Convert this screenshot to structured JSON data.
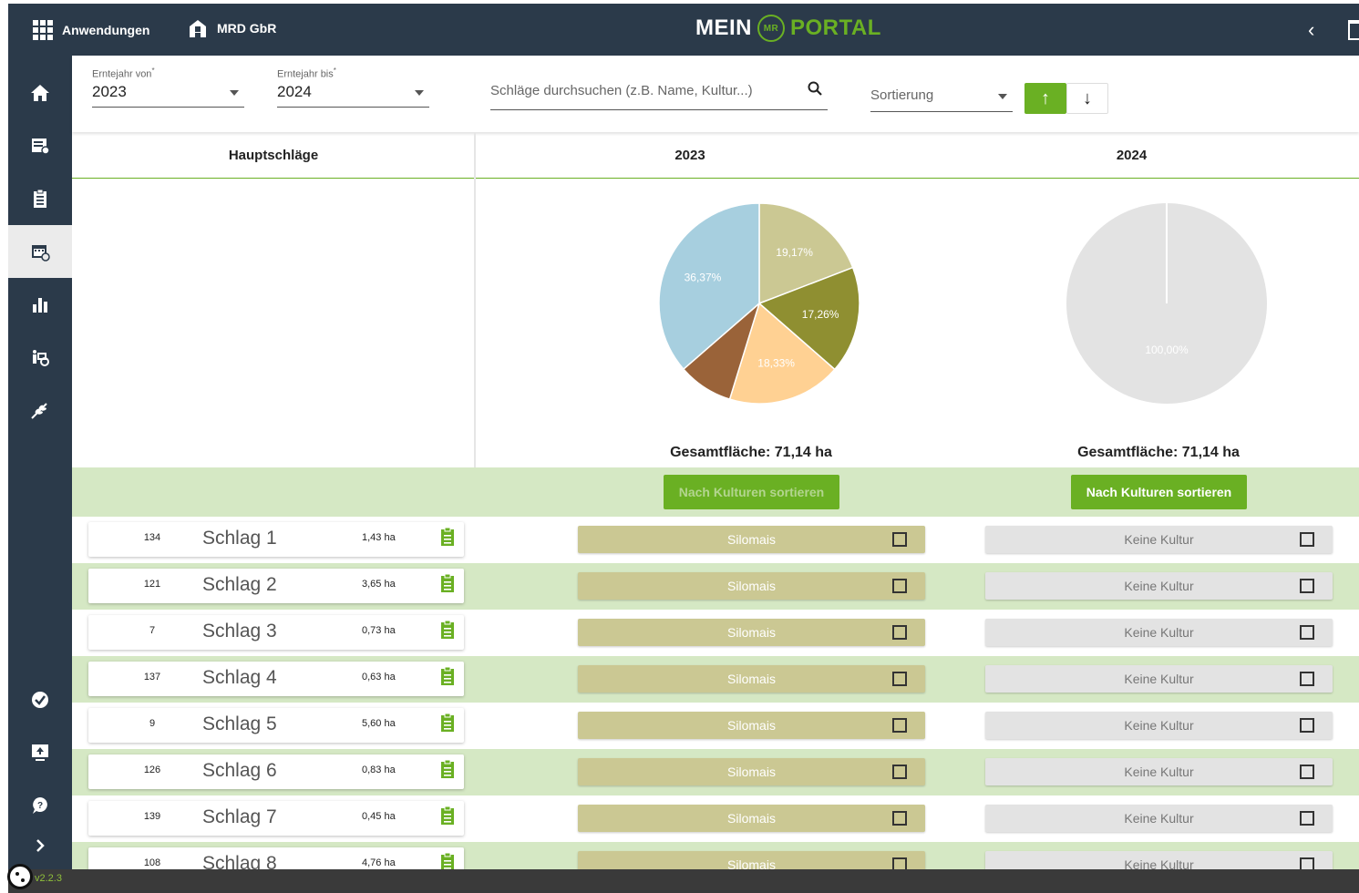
{
  "topbar": {
    "apps_label": "Anwendungen",
    "company_label": "MRD GbR",
    "logo_left": "MEIN",
    "logo_badge": "MR",
    "logo_right": "PORTAL"
  },
  "filters": {
    "year_from": {
      "label": "Erntejahr von",
      "value": "2023"
    },
    "year_to": {
      "label": "Erntejahr bis",
      "value": "2024"
    },
    "search_placeholder": "Schläge durchsuchen (z.B. Name, Kultur...)",
    "sort_label": "Sortierung",
    "sort_asc_symbol": "↑",
    "sort_desc_symbol": "↓"
  },
  "columns": {
    "main": "Hauptschläge",
    "year_a": "2023",
    "year_b": "2024"
  },
  "totals": {
    "year_a": "Gesamtfläche: 71,14 ha",
    "year_b": "Gesamtfläche: 71,14 ha"
  },
  "sort_by_culture": "Nach Kulturen sortieren",
  "chart_data": [
    {
      "type": "pie",
      "title": "2023",
      "slices": [
        {
          "label": "19,17%",
          "value": 19.17,
          "color": "#cbc893"
        },
        {
          "label": "17,26%",
          "value": 17.26,
          "color": "#8f8f31"
        },
        {
          "label": "18,33%",
          "value": 18.33,
          "color": "#ffd193"
        },
        {
          "label": "",
          "value": 8.87,
          "color": "#9a6339"
        },
        {
          "label": "36,37%",
          "value": 36.37,
          "color": "#a7cfdf"
        }
      ]
    },
    {
      "type": "pie",
      "title": "2024",
      "slices": [
        {
          "label": "100,00%",
          "value": 100.0,
          "color": "#e3e3e3"
        }
      ]
    }
  ],
  "rows": [
    {
      "nr": "134",
      "name": "Schlag 1",
      "ha": "1,43 ha",
      "culture_a": "Silomais",
      "culture_b": "Keine Kultur"
    },
    {
      "nr": "121",
      "name": "Schlag 2",
      "ha": "3,65 ha",
      "culture_a": "Silomais",
      "culture_b": "Keine Kultur"
    },
    {
      "nr": "7",
      "name": "Schlag 3",
      "ha": "0,73 ha",
      "culture_a": "Silomais",
      "culture_b": "Keine Kultur"
    },
    {
      "nr": "137",
      "name": "Schlag 4",
      "ha": "0,63 ha",
      "culture_a": "Silomais",
      "culture_b": "Keine Kultur"
    },
    {
      "nr": "9",
      "name": "Schlag 5",
      "ha": "5,60 ha",
      "culture_a": "Silomais",
      "culture_b": "Keine Kultur"
    },
    {
      "nr": "126",
      "name": "Schlag 6",
      "ha": "0,83 ha",
      "culture_a": "Silomais",
      "culture_b": "Keine Kultur"
    },
    {
      "nr": "139",
      "name": "Schlag 7",
      "ha": "0,45 ha",
      "culture_a": "Silomais",
      "culture_b": "Keine Kultur"
    },
    {
      "nr": "108",
      "name": "Schlag 8",
      "ha": "4,76 ha",
      "culture_a": "Silomais",
      "culture_b": "Keine Kultur"
    }
  ],
  "version": "v2.2.3",
  "colors": {
    "navy": "#2b3a4a",
    "green": "#6ab023",
    "light_green": "#d5e8c4"
  },
  "icons": {
    "sidebar": [
      "home-icon",
      "field-list-icon",
      "clipboard-icon",
      "calendar-icon",
      "bar-chart-icon",
      "tractor-icon",
      "wheat-icon",
      "settings-check-icon",
      "upload-icon",
      "help-icon",
      "chevron-right-icon"
    ]
  }
}
